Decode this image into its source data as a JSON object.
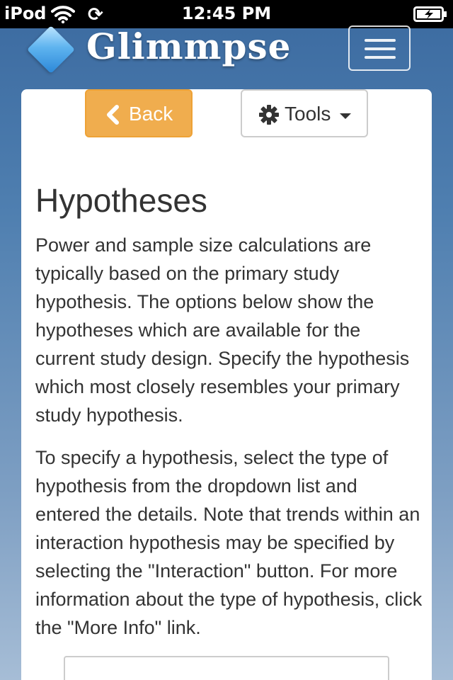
{
  "status_bar": {
    "carrier": "iPod",
    "time": "12:45 PM",
    "icons": [
      "wifi-icon",
      "sync-icon",
      "battery-charging-icon"
    ]
  },
  "header": {
    "app_name": "Glimmpse",
    "logo_icon": "diamond-logo-icon",
    "menu_icon": "hamburger-menu-icon"
  },
  "toolbar": {
    "back_label": "Back",
    "back_icon": "chevron-left-icon",
    "tools_label": "Tools",
    "tools_icon": "gear-icon",
    "tools_caret_icon": "caret-down-icon"
  },
  "main": {
    "title": "Hypotheses",
    "paragraphs": [
      "Power and sample size calculations are typically based on the primary study hypothesis. The options below show the hypotheses which are available for the current study design. Specify the hypothesis which most closely resembles your primary study hypothesis.",
      "To specify a hypothesis, select the type of hypothesis from the dropdown list and entered the details. Note that trends within an interaction hypothesis may be specified by selecting the \"Interaction\" button. For more information about the type of hypothesis, click the \"More Info\" link."
    ]
  },
  "colors": {
    "back_button": "#f0ad4e",
    "background_top": "#3b6aa0",
    "background_bottom": "#a6bdd6",
    "text": "#333333"
  }
}
